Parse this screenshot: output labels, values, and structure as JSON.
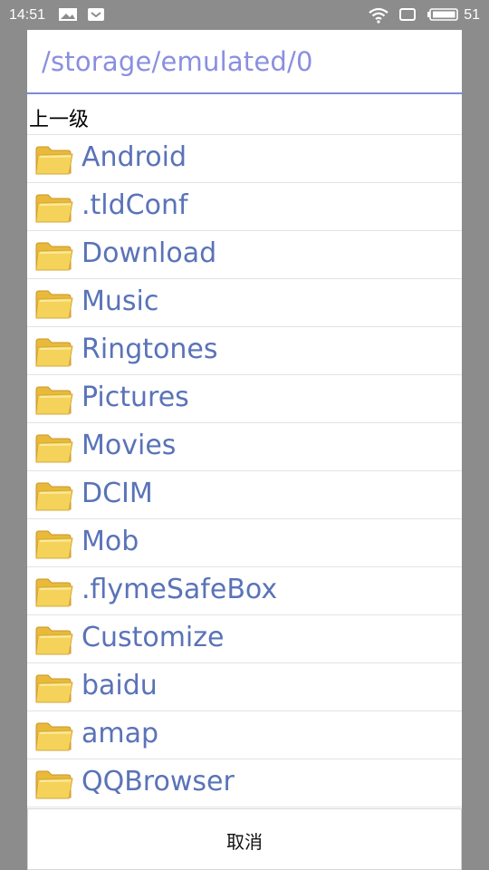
{
  "status_bar": {
    "time": "14:51",
    "battery_level": "51",
    "icons": [
      "photo-notification-icon",
      "security-icon",
      "wifi-icon",
      "screen-icon",
      "battery-icon"
    ]
  },
  "dialog": {
    "current_path": "/storage/emulated/0",
    "parent_label": "上一级",
    "folder_icon": "folder-icon",
    "folders": [
      {
        "name": "Android"
      },
      {
        "name": ".tldConf"
      },
      {
        "name": "Download"
      },
      {
        "name": "Music"
      },
      {
        "name": "Ringtones"
      },
      {
        "name": "Pictures"
      },
      {
        "name": "Movies"
      },
      {
        "name": "DCIM"
      },
      {
        "name": "Mob"
      },
      {
        "name": ".flymeSafeBox"
      },
      {
        "name": "Customize"
      },
      {
        "name": "baidu"
      },
      {
        "name": "amap"
      },
      {
        "name": "QQBrowser"
      }
    ],
    "cancel_label": "取消"
  },
  "colors": {
    "path_text": "#8a8fe0",
    "path_underline": "#7f88dd",
    "folder_name": "#5a73b8",
    "folder_fill": "#f5d35a",
    "overlay": "#8c8c8c"
  }
}
